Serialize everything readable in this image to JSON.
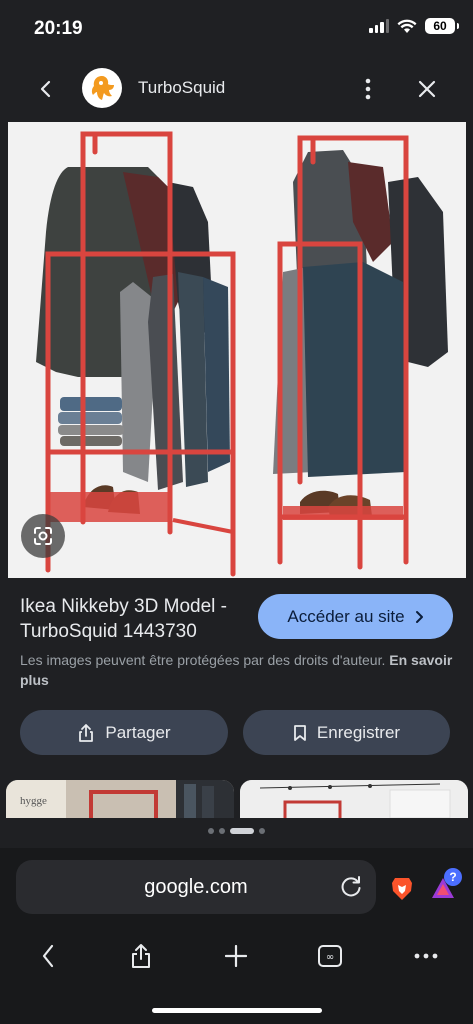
{
  "status": {
    "time": "20:19",
    "battery": "60"
  },
  "header": {
    "title": "TurboSquid"
  },
  "result": {
    "title": "Ikea Nikkeby 3D Model - TurboSquid 1443730",
    "visit_label": "Accéder au site",
    "copyright_text": "Les images peuvent être protégées par des droits d'auteur.",
    "learn_more": "En savoir plus",
    "share_label": "Partager",
    "save_label": "Enregistrer"
  },
  "browser": {
    "url": "google.com",
    "question_badge": "?"
  },
  "related": {
    "tile_1_text": "hygge"
  },
  "colors": {
    "accent": "#8ab4f8",
    "rack_red": "#d9453f",
    "background": "#1f2023",
    "button_bg": "#3c4453"
  },
  "icons": [
    "back-icon",
    "more-vertical-icon",
    "close-icon",
    "lens-icon",
    "chevron-right-icon",
    "share-icon",
    "bookmark-icon",
    "reload-icon",
    "brave-lion-icon",
    "brave-rewards-icon",
    "chevron-left-icon",
    "share-ios-icon",
    "plus-icon",
    "tabs-icon",
    "more-horizontal-icon"
  ]
}
